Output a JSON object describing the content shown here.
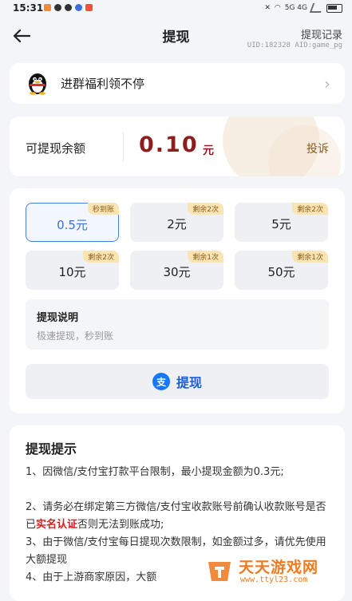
{
  "status_bar": {
    "time": "15:31",
    "right_text": "5G 4G"
  },
  "nav": {
    "title": "提现",
    "right_link": "提现记录",
    "uid_line": "UID:182328 AID:game_pg"
  },
  "group_banner": {
    "text": "进群福利领不停"
  },
  "balance": {
    "label": "可提现余额",
    "amount": "0.10",
    "unit": "元",
    "complaint": "投诉"
  },
  "options": [
    {
      "amount": "0.5元",
      "tag": "秒到账",
      "selected": true
    },
    {
      "amount": "2元",
      "tag": "剩余2次",
      "selected": false
    },
    {
      "amount": "5元",
      "tag": "剩余2次",
      "selected": false
    },
    {
      "amount": "10元",
      "tag": "剩余2次",
      "selected": false
    },
    {
      "amount": "30元",
      "tag": "剩余1次",
      "selected": false
    },
    {
      "amount": "50元",
      "tag": "剩余1次",
      "selected": false
    }
  ],
  "explain": {
    "title": "提现说明",
    "desc": "极速提现，秒到账"
  },
  "withdraw_button": {
    "icon_glyph": "支",
    "label": "提现"
  },
  "tips": {
    "title": "提现提示",
    "line1": "1、因微信/支付宝打款平台限制，最小提现金额为0.3元;",
    "line2_pre": "2、请务必在绑定第三方微信/支付宝收款账号前确认收款账号是否已",
    "line2_hl": "实名认证",
    "line2_post": "否则无法到账成功;",
    "line3": "3、由于微信/支付宝每日提现次数限制，如金额过多，请优先使用大额提现",
    "line4": "4、由于上游商家原因，大额"
  },
  "watermark": {
    "title": "天天游戏网",
    "url": "www.ttyl23.com"
  },
  "colors": {
    "accent_blue": "#3a70d8",
    "amount_red": "#8e1e1e",
    "tag_bg": "#fae4b4",
    "highlight_red": "#d02020"
  }
}
